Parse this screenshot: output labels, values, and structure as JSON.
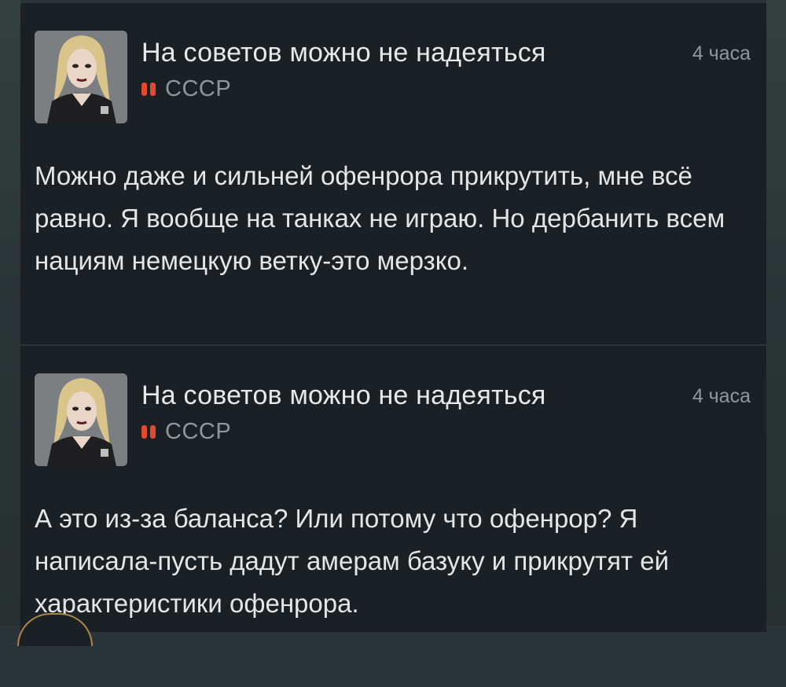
{
  "comments": [
    {
      "username": "На советов можно не надеяться",
      "time": "4 часа",
      "country": "СССР",
      "avatar_icon": "user-avatar-icon",
      "flag_icon": "flag-icon",
      "flag_color": "#e2492f",
      "text": "Можно даже и сильней офенрора прикрутить, мне всё равно. Я вообще на танках не играю. Но дербанить всем нациям немецкую ветку-это мерзко."
    },
    {
      "username": "На советов можно не надеяться",
      "time": "4 часа",
      "country": "СССР",
      "avatar_icon": "user-avatar-icon",
      "flag_icon": "flag-icon",
      "flag_color": "#e2492f",
      "text": "А это из-за баланса? Или потому что офенрор? Я написала-пусть дадут амерам базуку и прикрутят ей характеристики офенрора."
    }
  ],
  "colors": {
    "background": "#2b3538",
    "card": "#1b2025",
    "primary_text": "#e3e5e7",
    "secondary_text": "#8f979e",
    "divider": "#2e363d"
  }
}
